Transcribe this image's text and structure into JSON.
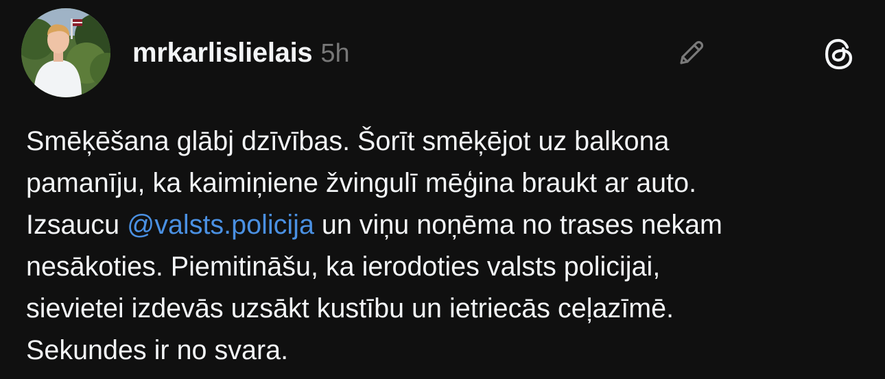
{
  "post": {
    "username": "mrkarlislielais",
    "time": "5h",
    "lines": [
      "Smēķēšana glābj dzīvības. Šorīt smēķējot uz balkona",
      "pamanīju, ka kaimiņiene žvingulī mēģina braukt ar auto.",
      {
        "before": "Izsaucu ",
        "mention": "@valsts.policija",
        "after": " un viņu noņēma no trases nekam"
      },
      "nesākoties. Piemitināšu, ka ierodoties valsts policijai,",
      "sievietei izdevās uzsākt kustību un ietriecās ceļazīmē.",
      "Sekundes ir no svara."
    ]
  },
  "icons": {
    "edit": "pencil-icon",
    "app": "threads-logo-icon"
  },
  "colors": {
    "background": "#101010",
    "text": "#f3f5f7",
    "muted": "#777777",
    "mention": "#4a90e2"
  }
}
